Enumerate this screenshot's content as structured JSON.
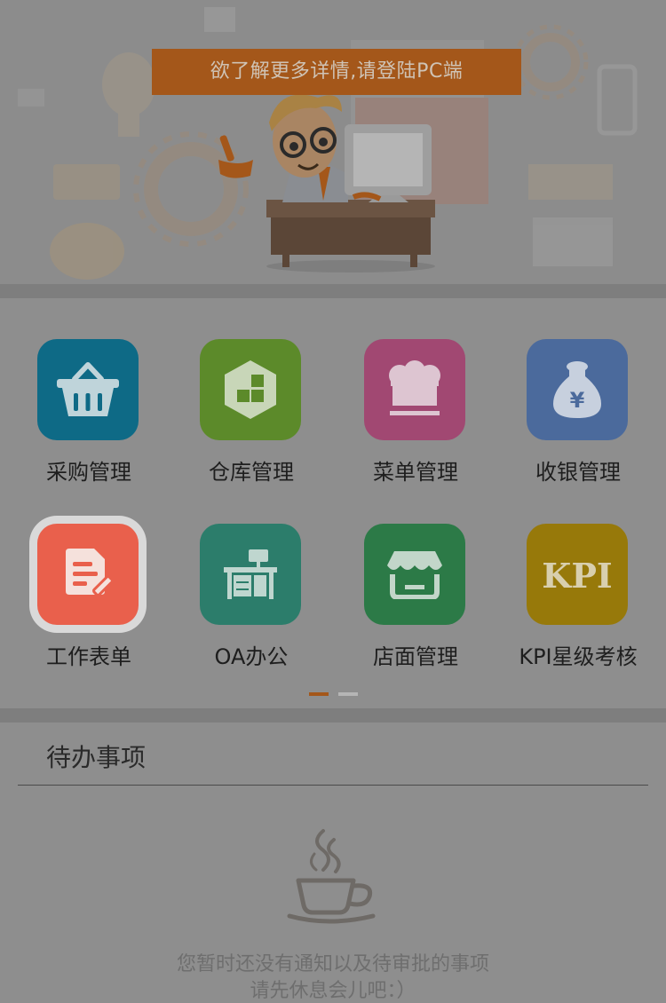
{
  "banner": {
    "notice": "欲了解更多详情,请登陆PC端"
  },
  "colors": {
    "notice_bg": "#a4571a",
    "purchase": "#0e6a86",
    "warehouse": "#5c8a2a",
    "menu": "#a14872",
    "cashier": "#4b6a9c",
    "work_form": "#e9604c",
    "oa": "#2c7d6b",
    "store": "#2c7a47",
    "kpi": "#97790a",
    "dot_active": "#a4571a",
    "dot_inactive": "#b5b5b5"
  },
  "apps": [
    {
      "label": "采购管理",
      "icon": "basket-icon"
    },
    {
      "label": "仓库管理",
      "icon": "warehouse-boxes-icon"
    },
    {
      "label": "菜单管理",
      "icon": "chef-hat-icon"
    },
    {
      "label": "收银管理",
      "icon": "money-bag-icon",
      "glyph": "¥"
    },
    {
      "label": "工作表单",
      "icon": "form-edit-icon"
    },
    {
      "label": "OA办公",
      "icon": "office-desk-icon"
    },
    {
      "label": "店面管理",
      "icon": "storefront-icon"
    },
    {
      "label": "KPI星级考核",
      "icon": "kpi-icon",
      "glyph": "KPI"
    }
  ],
  "pager": {
    "pages": 2,
    "current": 1
  },
  "todo": {
    "title": "待办事项",
    "empty_line1": "您暂时还没有通知以及待审批的事项",
    "empty_line2": "请先休息会儿吧：）"
  }
}
